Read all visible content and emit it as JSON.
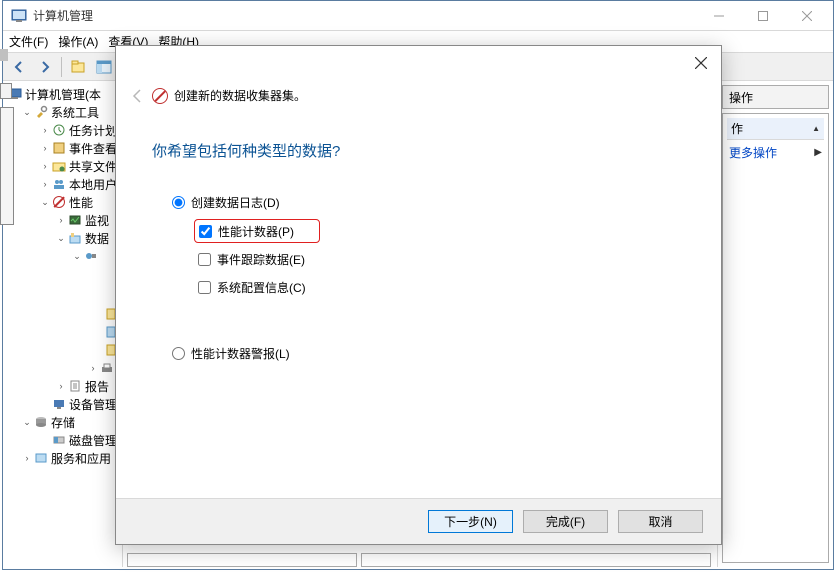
{
  "window": {
    "title": "计算机管理"
  },
  "menu": {
    "file": "文件(F)",
    "action": "操作(A)",
    "view": "查看(V)",
    "help": "帮助(H)"
  },
  "tree": {
    "root": "计算机管理(本",
    "systemTools": "系统工具",
    "taskScheduler": "任务计划",
    "eventViewer": "事件查看",
    "sharedFolders": "共享文件",
    "localUsers": "本地用户",
    "performance": "性能",
    "monitoring": "监视",
    "dataCollector": "数据",
    "reports": "报告",
    "deviceManager": "设备管理",
    "storage": "存储",
    "diskMgmt": "磁盘管理",
    "services": "服务和应用"
  },
  "actions": {
    "header": "操作",
    "moreActions": "更多操作",
    "sectionTitle": "作"
  },
  "dialog": {
    "headerText": "创建新的数据收集器集。",
    "prompt": "你希望包括何种类型的数据?",
    "radio1": "创建数据日志(D)",
    "check1": "性能计数器(P)",
    "check2": "事件跟踪数据(E)",
    "check3": "系统配置信息(C)",
    "radio2": "性能计数器警报(L)",
    "btnNext": "下一步(N)",
    "btnFinish": "完成(F)",
    "btnCancel": "取消"
  }
}
